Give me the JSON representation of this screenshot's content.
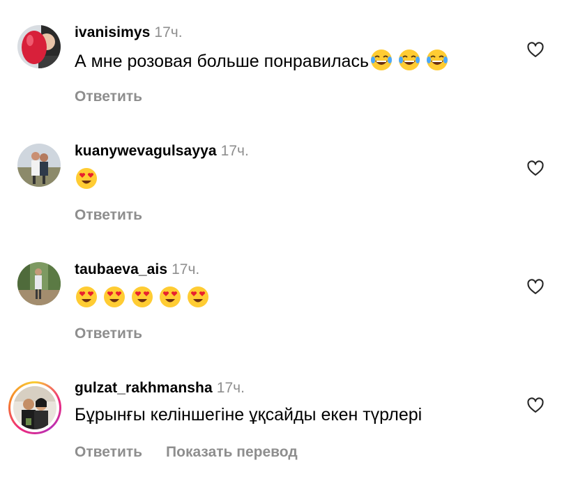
{
  "comments": [
    {
      "username": "ivanisimys",
      "time": "17ч.",
      "text": "А мне розовая больше понравилась",
      "emojis": [
        "laughing-tears",
        "laughing-tears",
        "laughing-tears"
      ],
      "reply_label": "Ответить",
      "avatar_colors": [
        "#d8203a",
        "#9aa3ad"
      ]
    },
    {
      "username": "kuanywevagulsayya",
      "time": "17ч.",
      "text": "",
      "emojis": [
        "heart-eyes"
      ],
      "reply_label": "Ответить",
      "avatar_colors": [
        "#c9ced6",
        "#6a7a5a"
      ]
    },
    {
      "username": "taubaeva_ais",
      "time": "17ч.",
      "text": "",
      "emojis": [
        "heart-eyes",
        "heart-eyes",
        "heart-eyes",
        "heart-eyes",
        "heart-eyes"
      ],
      "reply_label": "Ответить",
      "avatar_colors": [
        "#5d7a4a",
        "#8c6f53"
      ]
    },
    {
      "username": "gulzat_rakhmansha",
      "time": "17ч.",
      "text": "Бұрынғы келіншегіне ұқсайды екен түрлері",
      "emojis": [],
      "reply_label": "Ответить",
      "translate_label": "Показать перевод",
      "avatar_colors": [
        "#2b2b2b",
        "#b08a6a"
      ]
    }
  ],
  "colors": {
    "secondary_text": "#8e8e8e",
    "primary_text": "#000000",
    "story_ring": [
      "#f9ce34",
      "#ee2a7b",
      "#b82fb5"
    ]
  }
}
